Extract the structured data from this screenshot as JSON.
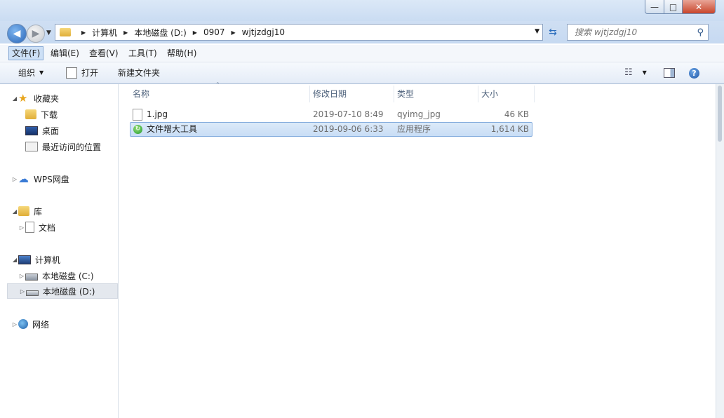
{
  "window": {
    "buttons": {
      "minimize": "—",
      "maximize": "□",
      "close": "✕"
    }
  },
  "address": {
    "crumbs": [
      "计算机",
      "本地磁盘 (D:)",
      "0907",
      "wjtjzdgj10"
    ],
    "search_placeholder": "搜索 wjtjzdgj10"
  },
  "menu": {
    "items": [
      "文件(F)",
      "编辑(E)",
      "查看(V)",
      "工具(T)",
      "帮助(H)"
    ],
    "active_index": 0
  },
  "toolbar": {
    "organize": "组织",
    "open": "打开",
    "new_folder": "新建文件夹"
  },
  "sidebar": {
    "favorites": "收藏夹",
    "downloads": "下载",
    "desktop": "桌面",
    "recent": "最近访问的位置",
    "wps": "WPS网盘",
    "libraries": "库",
    "documents": "文档",
    "computer": "计算机",
    "drive_c": "本地磁盘 (C:)",
    "drive_d": "本地磁盘 (D:)",
    "network": "网络"
  },
  "columns": {
    "name": "名称",
    "modified": "修改日期",
    "type": "类型",
    "size": "大小"
  },
  "files": [
    {
      "name": "1.jpg",
      "modified": "2019-07-10 8:49",
      "type": "qyimg_jpg",
      "size": "46 KB",
      "icon": "file-icon"
    },
    {
      "name": "文件增大工具",
      "modified": "2019-09-06 6:33",
      "type": "应用程序",
      "size": "1,614 KB",
      "icon": "app-icon"
    }
  ],
  "colors": {
    "selection": "#cce0f7",
    "accent": "#2a66b8"
  }
}
